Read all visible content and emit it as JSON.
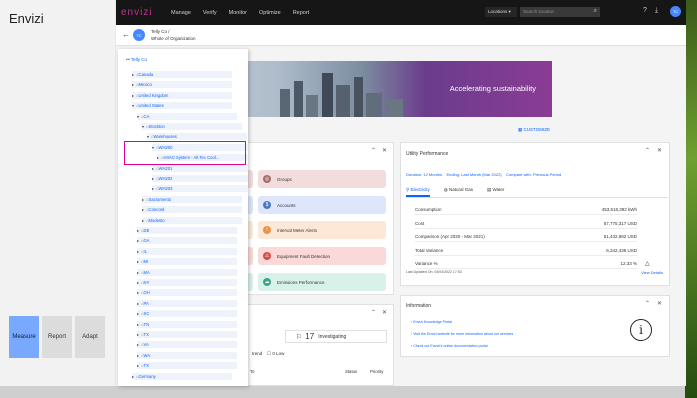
{
  "left_panel": {
    "title": "Envizi",
    "tabs": [
      {
        "label": "Measure",
        "active": true
      },
      {
        "label": "Report",
        "active": false
      },
      {
        "label": "Adapt",
        "active": false
      }
    ]
  },
  "topnav": {
    "brand": "envizi",
    "items": [
      "Manage",
      "Verify",
      "Monitor",
      "Optimize",
      "Report"
    ],
    "locations_label": "Locations",
    "search_placeholder": "Search location"
  },
  "subheader": {
    "org_initials": "TC",
    "breadcrumb_line1": "Telly Co /",
    "breadcrumb_line2": "Whole of Organization"
  },
  "banner": {
    "text": "Accelerating sustainability"
  },
  "customize_label": "CUSTOMIZE",
  "tree": {
    "root": "Telly Co",
    "nodes": [
      {
        "label": "Canada",
        "depth": 1,
        "caret": "▸"
      },
      {
        "label": "Mexico",
        "depth": 1,
        "caret": "▸"
      },
      {
        "label": "United Kingdom",
        "depth": 1,
        "caret": "▸"
      },
      {
        "label": "United States",
        "depth": 1,
        "caret": "▾"
      },
      {
        "label": "CA",
        "depth": 2,
        "caret": "▾"
      },
      {
        "label": "Stockton",
        "depth": 3,
        "caret": "▾"
      },
      {
        "label": "Warehouses",
        "depth": 4,
        "caret": "▾"
      },
      {
        "label": "WH200",
        "depth": 5,
        "caret": "▾"
      },
      {
        "label": "HVAC System - Alt Tec Cool...",
        "depth": 6,
        "caret": "▸"
      },
      {
        "label": "WH201",
        "depth": 5,
        "caret": "▸"
      },
      {
        "label": "WH202",
        "depth": 5,
        "caret": "▸"
      },
      {
        "label": "WH203",
        "depth": 5,
        "caret": "▸"
      },
      {
        "label": "Sacramento",
        "depth": 3,
        "caret": "▸"
      },
      {
        "label": "Concord",
        "depth": 3,
        "caret": "▸"
      },
      {
        "label": "Modesto",
        "depth": 3,
        "caret": "▸"
      },
      {
        "label": "DE",
        "depth": 2,
        "caret": "▸"
      },
      {
        "label": "GA",
        "depth": 2,
        "caret": "▸"
      },
      {
        "label": "IL",
        "depth": 2,
        "caret": "▸"
      },
      {
        "label": "MI",
        "depth": 2,
        "caret": "▸"
      },
      {
        "label": "MA",
        "depth": 2,
        "caret": "▸"
      },
      {
        "label": "NY",
        "depth": 2,
        "caret": "▸"
      },
      {
        "label": "OH",
        "depth": 2,
        "caret": "▸"
      },
      {
        "label": "PA",
        "depth": 2,
        "caret": "▸"
      },
      {
        "label": "SC",
        "depth": 2,
        "caret": "▸"
      },
      {
        "label": "TN",
        "depth": 2,
        "caret": "▸"
      },
      {
        "label": "TX",
        "depth": 2,
        "caret": "▸"
      },
      {
        "label": "VA",
        "depth": 2,
        "caret": "▸"
      },
      {
        "label": "WA",
        "depth": 2,
        "caret": "▸"
      },
      {
        "label": "TX",
        "depth": 2,
        "caret": "▸"
      },
      {
        "label": "Germany",
        "depth": 1,
        "caret": "▸"
      }
    ]
  },
  "quick_tiles": [
    {
      "label": "Groups",
      "icon": "groups-icon",
      "bg": "#f2dcdc",
      "icon_bg": "#a56a6a"
    },
    {
      "label": "Accounts",
      "icon": "accounts-icon",
      "bg": "#dde6fb",
      "icon_bg": "#4a78c8"
    },
    {
      "label": "Interval Meter Alerts",
      "icon": "alert-icon",
      "bg": "#fde8d8",
      "icon_bg": "#e8934a"
    },
    {
      "label": "Equipment Fault Detection",
      "icon": "fault-icon",
      "bg": "#fbd9d9",
      "icon_bg": "#d94a4a"
    },
    {
      "label": "Emissions Performance",
      "icon": "emissions-icon",
      "bg": "#d8f2ea",
      "icon_bg": "#3aa58a"
    }
  ],
  "utility": {
    "title": "Utility Performance",
    "duration": "Duration: 12 Months",
    "ending": "Ending: Last Month (Mar 2022)",
    "compare": "Compare with: Previous Period",
    "tabs": [
      {
        "label": "Electricity",
        "icon": "⚲",
        "active": true
      },
      {
        "label": "Natural Gas",
        "icon": "◍",
        "active": false
      },
      {
        "label": "Water",
        "icon": "▤",
        "active": false
      }
    ],
    "metrics": [
      {
        "label": "Consumption",
        "value": "453,518,392 kWh"
      },
      {
        "label": "Cost",
        "value": "57,775,317 USD"
      },
      {
        "label": "Comparison (Apr 2020 - Mar 2021)",
        "value": "51,432,882 USD"
      },
      {
        "label": "Total Variance",
        "value": "6,342,435 USD"
      },
      {
        "label": "Variance %",
        "value": "12.33 %"
      }
    ],
    "updated": "Last Updated On: 04/04/2022 17:53",
    "view_details": "View Details"
  },
  "information": {
    "title": "Information",
    "links": [
      "Envizi Knowledge Portal",
      "Visit the Envizi website for more information about our services",
      "Check out Envizi's online documentation portal"
    ]
  },
  "bottom_card": {
    "investigating_count": "17",
    "investigating_label": "Investigating",
    "low_label": "0 Low",
    "col_status": "Status",
    "col_priority": "Priority",
    "col_to": "To",
    "trend_label": "trend"
  }
}
